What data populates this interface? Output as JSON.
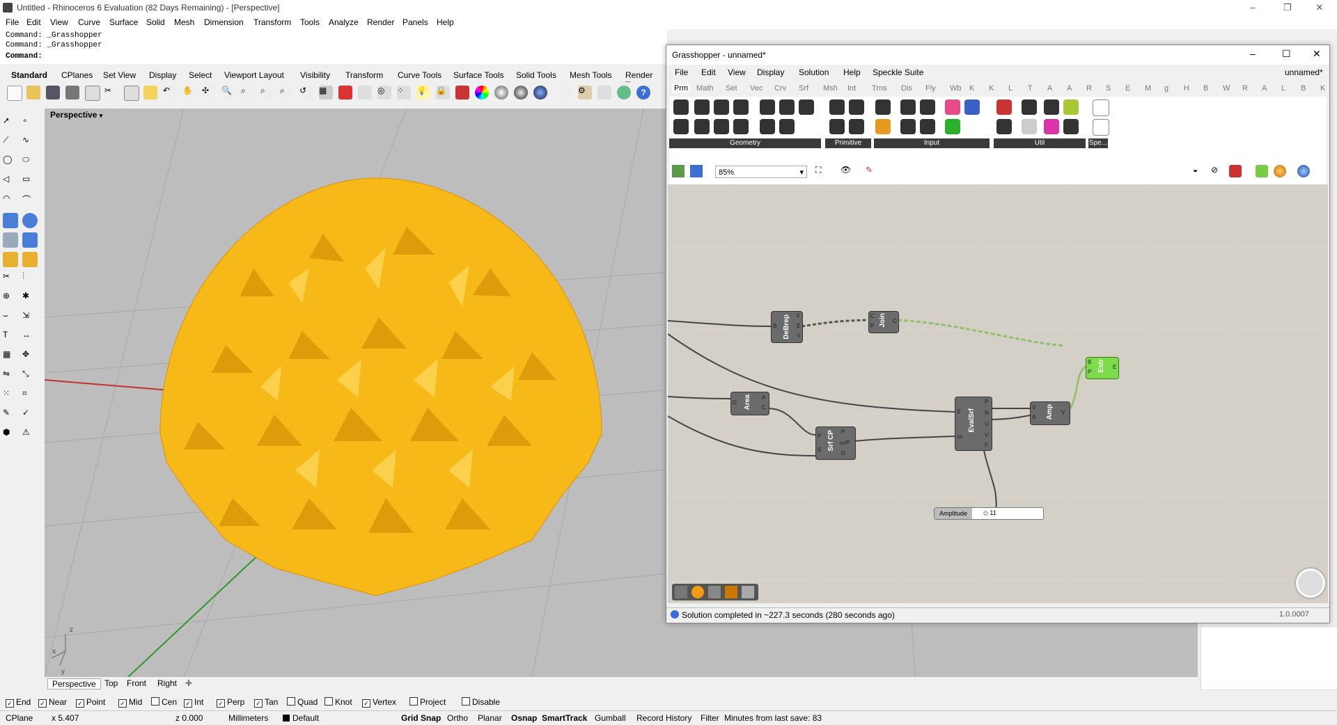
{
  "window_title": "Untitled - Rhinoceros 6 Evaluation (82 Days Remaining) - [Perspective]",
  "menu": [
    "File",
    "Edit",
    "View",
    "Curve",
    "Surface",
    "Solid",
    "Mesh",
    "Dimension",
    "Transform",
    "Tools",
    "Analyze",
    "Render",
    "Panels",
    "Help"
  ],
  "command_history": [
    "Command: _Grasshopper",
    "Command: _Grasshopper"
  ],
  "command_prompt": "Command:",
  "toolbar_tabs": [
    "Standard",
    "CPlanes",
    "Set View",
    "Display",
    "Select",
    "Viewport Layout",
    "Visibility",
    "Transform",
    "Curve Tools",
    "Surface Tools",
    "Solid Tools",
    "Mesh Tools",
    "Render Too"
  ],
  "viewport": {
    "label": "Perspective",
    "tabs": [
      "Perspective",
      "Top",
      "Front",
      "Right"
    ],
    "axis_labels": [
      "x",
      "y",
      "z"
    ]
  },
  "osnap": [
    {
      "label": "End",
      "checked": true
    },
    {
      "label": "Near",
      "checked": true
    },
    {
      "label": "Point",
      "checked": true
    },
    {
      "label": "Mid",
      "checked": true
    },
    {
      "label": "Cen",
      "checked": false
    },
    {
      "label": "Int",
      "checked": true
    },
    {
      "label": "Perp",
      "checked": true
    },
    {
      "label": "Tan",
      "checked": true
    },
    {
      "label": "Quad",
      "checked": false
    },
    {
      "label": "Knot",
      "checked": false
    },
    {
      "label": "Vertex",
      "checked": true
    },
    {
      "label": "Project",
      "checked": false
    },
    {
      "label": "Disable",
      "checked": false
    }
  ],
  "status": {
    "cplane": "CPlane",
    "x": "x 5.407",
    "z": "z 0.000",
    "units": "Millimeters",
    "layer": "Default",
    "toggles": [
      "Grid Snap",
      "Ortho",
      "Planar",
      "Osnap",
      "SmartTrack",
      "Gumball",
      "Record History",
      "Filter"
    ],
    "save_info": "Minutes from last save: 83"
  },
  "grasshopper": {
    "title": "Grasshopper - unnamed*",
    "doc_name": "unnamed*",
    "menu": [
      "File",
      "Edit",
      "View",
      "Display",
      "Solution",
      "Help",
      "Speckle Suite"
    ],
    "tabs": [
      "Prm",
      "Math",
      "Set",
      "Vec",
      "Crv",
      "Srf",
      "Msh",
      "Int",
      "Trns",
      "Dis",
      "Fly",
      "Wb",
      "K",
      "K",
      "L",
      "T",
      "A",
      "A",
      "R",
      "S",
      "E",
      "M",
      "g",
      "H",
      "B",
      "W",
      "R",
      "A",
      "L",
      "B",
      "K"
    ],
    "groups": [
      "Geometry",
      "Primitive",
      "Input",
      "Util",
      "Spe..."
    ],
    "zoom": "85%",
    "components": {
      "debrep": {
        "name": "DeBrep",
        "inputs": [
          "B"
        ],
        "outputs": [
          "F",
          "E",
          "V"
        ]
      },
      "join": {
        "name": "Join",
        "inputs": [
          "C",
          "P"
        ],
        "outputs": [
          "C"
        ]
      },
      "extr": {
        "name": "Extr",
        "inputs": [
          "B",
          "P"
        ],
        "outputs": [
          "E"
        ]
      },
      "area": {
        "name": "Area",
        "inputs": [
          "G"
        ],
        "outputs": [
          "A",
          "C"
        ]
      },
      "srfcp": {
        "name": "Srf CP",
        "inputs": [
          "P",
          "S"
        ],
        "outputs": [
          "P",
          "uvP",
          "D"
        ]
      },
      "evalsrf": {
        "name": "EvalSrf",
        "inputs": [
          "S",
          "uv"
        ],
        "outputs": [
          "P",
          "N",
          "U",
          "V",
          "F"
        ]
      },
      "amp": {
        "name": "Amp",
        "inputs": [
          "V",
          "A"
        ],
        "outputs": [
          "V"
        ]
      },
      "slider": {
        "label": "Amplitude",
        "value": "◇ 11"
      }
    },
    "status_message": "Solution completed in ~227.3 seconds (280 seconds ago)",
    "version": "1.0.0007"
  }
}
